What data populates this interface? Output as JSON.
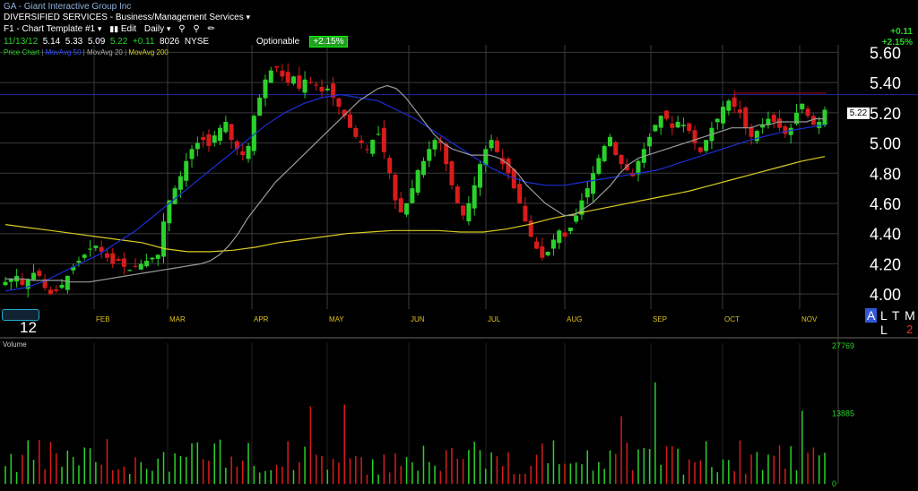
{
  "header": {
    "title": "GA - Giant Interactive Group Inc",
    "sector": "DIVERSIFIED SERVICES - Business/Management Services",
    "toolbar": {
      "template": "F1 - Chart Template #1",
      "edit": "Edit",
      "interval": "Daily"
    },
    "quote": {
      "date": "11/13/12",
      "open": "5.14",
      "high": "5.33",
      "low": "5.09",
      "close": "5.22",
      "change": "+0.11",
      "volume": "8026",
      "exchange": "NYSE",
      "optionable": "Optionable",
      "change_pct": "+2.15%"
    },
    "top_change_abs": "+0.11",
    "top_change_pct": "+2.15%"
  },
  "legend": {
    "price": "Price Chart",
    "ma50": "MovAvg 50",
    "ma20": "MovAvg 20",
    "ma200": "MovAvg 200"
  },
  "colors": {
    "up": "#2bd12b",
    "down": "#d81b1b",
    "ma50": "#1c2fd6",
    "ma20": "#9a9a9a",
    "ma200": "#d8cc22",
    "resistance": "#1e2a9a",
    "grid": "#3a3a3a"
  },
  "period_label": "12",
  "mode": {
    "a": "A",
    "rest": "L T M L",
    "num": "2"
  },
  "volume_panel": {
    "label": "Volume"
  },
  "price_tag": "5.22",
  "chart_data": {
    "type": "candlestick",
    "y_ticks": [
      "5.60",
      "5.40",
      "5.20",
      "5.00",
      "4.80",
      "4.60",
      "4.40",
      "4.20",
      "4.00"
    ],
    "ylim": [
      3.9,
      5.65
    ],
    "months": [
      "FEB",
      "MAR",
      "APR",
      "MAY",
      "JUN",
      "JUL",
      "AUG",
      "SEP",
      "OCT",
      "NOV"
    ],
    "resistance_level": 5.32,
    "last_close": 5.22,
    "volume_ticks": [
      "27769",
      "13885",
      "0"
    ],
    "volume_max": 27769,
    "close_series": [
      4.08,
      4.1,
      4.12,
      4.06,
      4.1,
      4.14,
      4.12,
      4.04,
      4.0,
      4.02,
      4.06,
      4.12,
      4.18,
      4.22,
      4.26,
      4.3,
      4.32,
      4.28,
      4.24,
      4.2,
      4.22,
      4.18,
      4.16,
      4.18,
      4.2,
      4.22,
      4.24,
      4.26,
      4.48,
      4.62,
      4.7,
      4.78,
      4.88,
      4.96,
      5.0,
      5.02,
      4.98,
      5.05,
      5.1,
      5.14,
      5.02,
      4.96,
      4.92,
      4.98,
      5.18,
      5.3,
      5.42,
      5.48,
      5.5,
      5.44,
      5.4,
      5.44,
      5.36,
      5.42,
      5.4,
      5.38,
      5.34,
      5.36,
      5.3,
      5.24,
      5.18,
      5.1,
      5.04,
      5.0,
      4.96,
      5.02,
      5.06,
      4.94,
      4.8,
      4.62,
      4.54,
      4.6,
      4.7,
      4.82,
      4.88,
      4.96,
      5.02,
      5.0,
      4.86,
      4.72,
      4.6,
      4.52,
      4.6,
      4.72,
      4.86,
      4.96,
      5.02,
      4.94,
      4.86,
      4.8,
      4.7,
      4.6,
      4.48,
      4.38,
      4.3,
      4.24,
      4.28,
      4.36,
      4.42,
      4.38,
      4.44,
      4.52,
      4.62,
      4.7,
      4.8,
      4.9,
      4.98,
      5.04,
      4.92,
      4.86,
      4.82,
      4.78,
      4.88,
      4.96,
      5.04,
      5.12,
      5.18,
      5.16,
      5.1,
      5.14,
      5.12,
      5.08,
      5.0,
      4.94,
      5.02,
      5.1,
      5.16,
      5.24,
      5.28,
      5.24,
      5.2,
      5.1,
      5.04,
      5.08,
      5.12,
      5.16,
      5.14,
      5.1,
      5.06,
      5.1,
      5.2,
      5.26,
      5.18,
      5.12,
      5.14,
      5.22
    ],
    "ma20": [
      4.1,
      4.1,
      4.1,
      4.09,
      4.09,
      4.09,
      4.09,
      4.08,
      4.08,
      4.08,
      4.09,
      4.1,
      4.11,
      4.12,
      4.13,
      4.14,
      4.15,
      4.16,
      4.17,
      4.18,
      4.19,
      4.2,
      4.22,
      4.26,
      4.32,
      4.4,
      4.5,
      4.58,
      4.66,
      4.74,
      4.8,
      4.86,
      4.92,
      4.98,
      5.04,
      5.1,
      5.16,
      5.22,
      5.28,
      5.32,
      5.36,
      5.38,
      5.36,
      5.3,
      5.22,
      5.14,
      5.06,
      5.0,
      4.96,
      4.94,
      4.92,
      4.92,
      4.92,
      4.9,
      4.86,
      4.8,
      4.72,
      4.66,
      4.6,
      4.56,
      4.52,
      4.52,
      4.56,
      4.6,
      4.66,
      4.72,
      4.8,
      4.86,
      4.9,
      4.92,
      4.94,
      4.96,
      4.98,
      5.0,
      5.02,
      5.04,
      5.06,
      5.08,
      5.1,
      5.1,
      5.1,
      5.12,
      5.12,
      5.14,
      5.14,
      5.14,
      5.14,
      5.16,
      5.16
    ],
    "ma50": [
      4.02,
      4.04,
      4.08,
      4.14,
      4.2,
      4.26,
      4.34,
      4.42,
      4.52,
      4.62,
      4.72,
      4.82,
      4.92,
      5.02,
      5.12,
      5.2,
      5.26,
      5.3,
      5.32,
      5.3,
      5.28,
      5.22,
      5.16,
      5.08,
      5.0,
      4.92,
      4.84,
      4.78,
      4.74,
      4.72,
      4.72,
      4.74,
      4.76,
      4.78,
      4.8,
      4.82,
      4.86,
      4.9,
      4.94,
      4.98,
      5.02,
      5.05,
      5.08,
      5.1,
      5.12
    ],
    "ma200": [
      4.46,
      4.44,
      4.42,
      4.4,
      4.38,
      4.36,
      4.34,
      4.3,
      4.28,
      4.28,
      4.29,
      4.31,
      4.34,
      4.36,
      4.38,
      4.4,
      4.41,
      4.42,
      4.42,
      4.42,
      4.41,
      4.41,
      4.43,
      4.46,
      4.5,
      4.53,
      4.56,
      4.59,
      4.62,
      4.65,
      4.68,
      4.72,
      4.76,
      4.8,
      4.84,
      4.88,
      4.91
    ]
  }
}
